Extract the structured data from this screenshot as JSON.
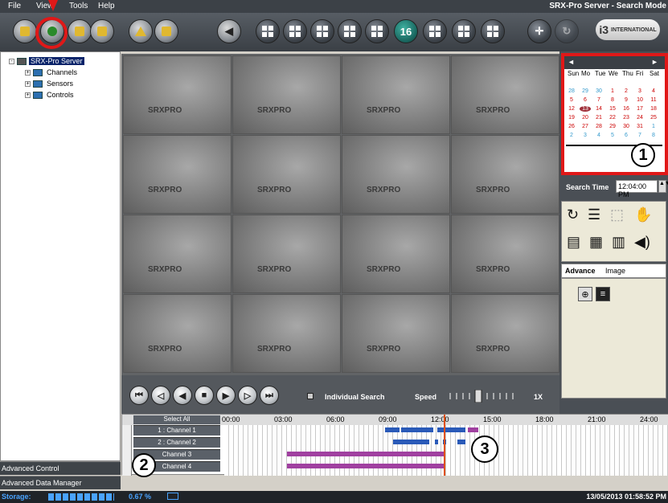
{
  "menu": {
    "file": "File",
    "view": "View",
    "tools": "Tools",
    "help": "Help",
    "title": "SRX-Pro Server - Search Mode"
  },
  "logo": {
    "text": "INTERNATIONAL",
    "mark": "i3"
  },
  "toolbar": {
    "split16": "16"
  },
  "tree": {
    "root": "SRX-Pro Server",
    "items": [
      "Channels",
      "Sensors",
      "Controls"
    ]
  },
  "left_tabs": {
    "advanced_control": "Advanced Control",
    "advanced_data_manager": "Advanced Data Manager"
  },
  "video": {
    "brand": "SRXPRO"
  },
  "controls": {
    "individual_search": "Individual Search",
    "speed": "Speed",
    "speed_value": "1X"
  },
  "calendar": {
    "weekdays": [
      "Sun",
      "Mo",
      "Tue",
      "We",
      "Thu",
      "Fri",
      "Sat"
    ],
    "rows": [
      [
        "28",
        "29",
        "30",
        "1",
        "2",
        "3",
        "4"
      ],
      [
        "5",
        "6",
        "7",
        "8",
        "9",
        "10",
        "11"
      ],
      [
        "12",
        "13",
        "14",
        "15",
        "16",
        "17",
        "18"
      ],
      [
        "19",
        "20",
        "21",
        "22",
        "23",
        "24",
        "25"
      ],
      [
        "26",
        "27",
        "28",
        "29",
        "30",
        "31",
        "1"
      ],
      [
        "2",
        "3",
        "4",
        "5",
        "6",
        "7",
        "8"
      ]
    ],
    "selected": "13"
  },
  "search": {
    "label": "Search Time",
    "value": "12:04:00 PM"
  },
  "tabs": {
    "advance": "Advance",
    "image": "Image"
  },
  "timeline": {
    "select_all": "Select All",
    "ticks": [
      "00:00",
      "03:00",
      "06:00",
      "09:00",
      "12:00",
      "15:00",
      "18:00",
      "21:00",
      "24:00"
    ],
    "channels": [
      "1 : Channel 1",
      "2 : Channel 2",
      "Channel 3",
      "Channel 4"
    ]
  },
  "status": {
    "storage_label": "Storage:",
    "percent": "0.67 %",
    "datetime": "13/05/2013  01:58:52 PM"
  },
  "callouts": [
    "1",
    "2",
    "3"
  ]
}
